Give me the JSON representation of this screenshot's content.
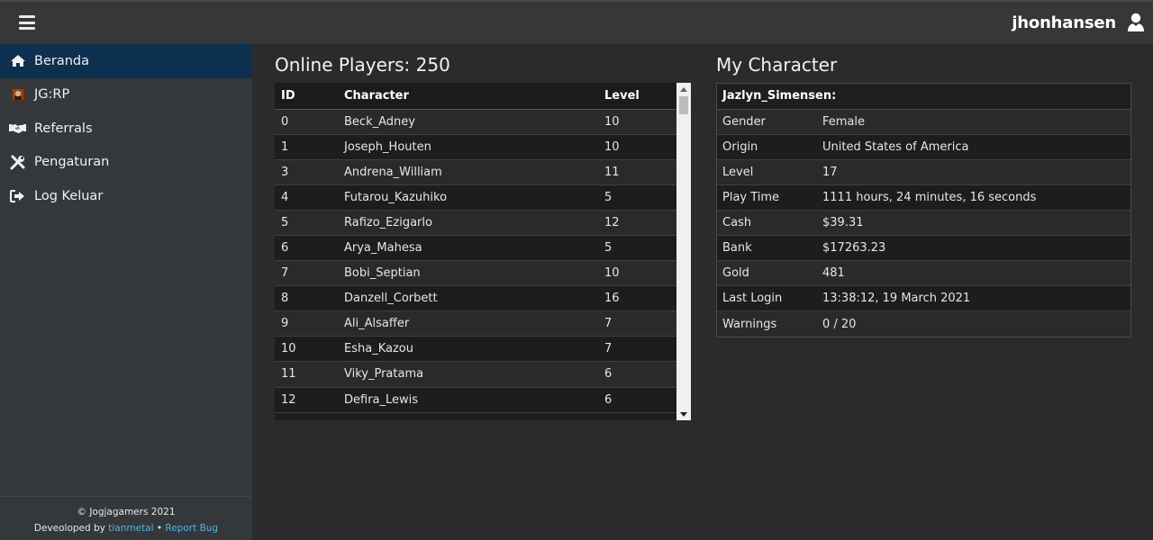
{
  "header": {
    "username": "jhonhansen"
  },
  "sidebar": {
    "items": [
      {
        "label": "Beranda",
        "icon": "home-icon"
      },
      {
        "label": "JG:RP",
        "icon": "game-thumbnail-icon"
      },
      {
        "label": "Referrals",
        "icon": "handshake-icon"
      },
      {
        "label": "Pengaturan",
        "icon": "tools-icon"
      },
      {
        "label": "Log Keluar",
        "icon": "sign-out-icon"
      }
    ],
    "active_index": 0,
    "footer": {
      "copyright": "© Jogjagamers 2021",
      "developed_by": "Deveoloped by",
      "author_link": "tianmetal",
      "separator": "•",
      "report_link": "Report Bug"
    }
  },
  "players": {
    "title": "Online Players: 250",
    "columns": [
      "ID",
      "Character",
      "Level"
    ],
    "rows": [
      [
        "0",
        "Beck_Adney",
        "10"
      ],
      [
        "1",
        "Joseph_Houten",
        "10"
      ],
      [
        "3",
        "Andrena_William",
        "11"
      ],
      [
        "4",
        "Futarou_Kazuhiko",
        "5"
      ],
      [
        "5",
        "Rafizo_Ezigarlo",
        "12"
      ],
      [
        "6",
        "Arya_Mahesa",
        "5"
      ],
      [
        "7",
        "Bobi_Septian",
        "10"
      ],
      [
        "8",
        "Danzell_Corbett",
        "16"
      ],
      [
        "9",
        "Ali_Alsaffer",
        "7"
      ],
      [
        "10",
        "Esha_Kazou",
        "7"
      ],
      [
        "11",
        "Viky_Pratama",
        "6"
      ],
      [
        "12",
        "Defira_Lewis",
        "6"
      ]
    ]
  },
  "character": {
    "title": "My Character",
    "name": "Jazlyn_Simensen:",
    "fields": [
      [
        "Gender",
        "Female"
      ],
      [
        "Origin",
        "United States of America"
      ],
      [
        "Level",
        "17"
      ],
      [
        "Play Time",
        "1111 hours, 24 minutes, 16 seconds"
      ],
      [
        "Cash",
        "$39.31"
      ],
      [
        "Bank",
        "$17263.23"
      ],
      [
        "Gold",
        "481"
      ],
      [
        "Last Login",
        "13:38:12, 19 March 2021"
      ],
      [
        "Warnings",
        "0 / 20"
      ]
    ]
  },
  "colors": {
    "active_nav": "#0d3050",
    "link": "#5ab0e0"
  }
}
